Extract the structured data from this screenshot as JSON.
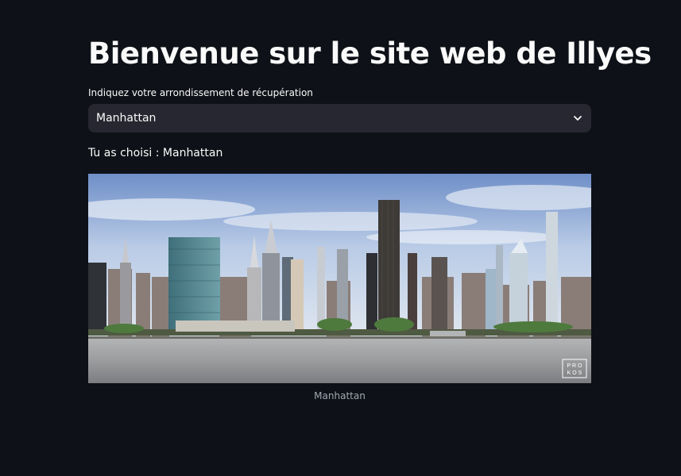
{
  "page": {
    "title": "Bienvenue sur le site web de Illyes"
  },
  "select": {
    "label": "Indiquez votre arrondissement de récupération",
    "value": "Manhattan",
    "icon": "chevron-down-icon"
  },
  "chosen": {
    "prefix": "Tu as choisi : ",
    "value": "Manhattan"
  },
  "image": {
    "description_icon": "city-skyline-photo",
    "watermark": "PROKOS",
    "caption": "Manhattan"
  },
  "colors": {
    "background": "#0e1117",
    "text": "#fafafa",
    "select_bg": "#262730",
    "caption": "#a3a8b4"
  }
}
